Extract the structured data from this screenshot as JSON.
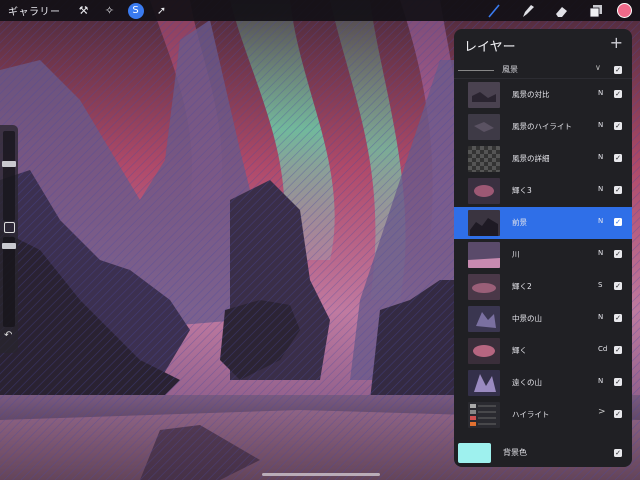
{
  "toolbar": {
    "gallery_label": "ギャラリー",
    "tools_left": [
      {
        "icon": "wrench-icon",
        "glyph": "⚒"
      },
      {
        "icon": "magic-wand-icon",
        "glyph": "✧"
      },
      {
        "icon": "selection-icon",
        "glyph": "S"
      },
      {
        "icon": "transform-arrow-icon",
        "glyph": "➚"
      }
    ],
    "tools_right": [
      "brush-icon",
      "smudge-icon",
      "eraser-icon",
      "layers-icon"
    ],
    "current_color": "#f06a8a"
  },
  "sidebar": {
    "undo_glyph": "↶"
  },
  "layers_panel": {
    "title": "レイヤー",
    "add_glyph": "+",
    "group": {
      "name": "風景",
      "chevron": "∨",
      "check": "✓"
    },
    "layers": [
      {
        "name": "風景の対比",
        "mode": "N",
        "check": "✓"
      },
      {
        "name": "風景のハイライト",
        "mode": "N",
        "check": "✓"
      },
      {
        "name": "風景の詳細",
        "mode": "N",
        "check": "✓"
      },
      {
        "name": "輝く3",
        "mode": "N",
        "check": "✓"
      },
      {
        "name": "前景",
        "mode": "N",
        "check": "✓",
        "selected": true
      },
      {
        "name": "川",
        "mode": "N",
        "check": "✓"
      },
      {
        "name": "輝く2",
        "mode": "S",
        "check": "✓"
      },
      {
        "name": "中景の山",
        "mode": "N",
        "check": "✓"
      },
      {
        "name": "輝く",
        "mode": "Cd",
        "check": "✓"
      },
      {
        "name": "遠くの山",
        "mode": "N",
        "check": "✓"
      },
      {
        "name": "ハイライト",
        "mode": "",
        "chevron": ">",
        "check": "✓"
      }
    ],
    "background": {
      "name": "背景色",
      "color": "#9ef1ee",
      "check": "✓"
    }
  },
  "colors": {
    "accent": "#2f6fe8",
    "panel": "#202024"
  }
}
